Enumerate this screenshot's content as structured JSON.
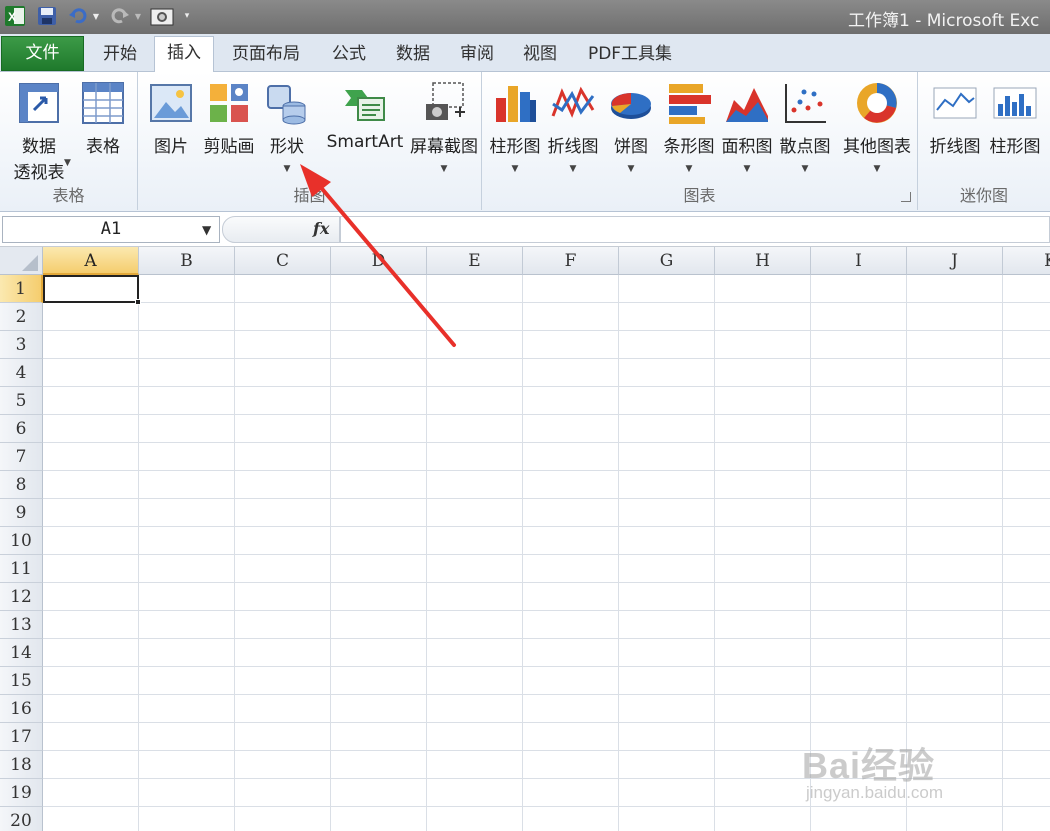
{
  "titlebar": {
    "app_title": "工作簿1 - Microsoft Exc"
  },
  "tabs": [
    {
      "label": "文件"
    },
    {
      "label": "开始"
    },
    {
      "label": "插入"
    },
    {
      "label": "页面布局"
    },
    {
      "label": "公式"
    },
    {
      "label": "数据"
    },
    {
      "label": "审阅"
    },
    {
      "label": "视图"
    },
    {
      "label": "PDF工具集"
    }
  ],
  "ribbon": {
    "groups": [
      {
        "label": "表格"
      },
      {
        "label": "插图"
      },
      {
        "label": "图表"
      },
      {
        "label": "迷你图"
      }
    ],
    "buttons": {
      "pivot_line1": "数据",
      "pivot_line2": "透视表",
      "table": "表格",
      "picture": "图片",
      "clipart": "剪贴画",
      "shapes": "形状",
      "smartart": "SmartArt",
      "screenshot": "屏幕截图",
      "column_chart": "柱形图",
      "line_chart": "折线图",
      "pie_chart": "饼图",
      "bar_chart": "条形图",
      "area_chart": "面积图",
      "scatter_chart": "散点图",
      "other_charts": "其他图表",
      "sparkline_line": "折线图",
      "sparkline_column": "柱形图"
    }
  },
  "formula_bar": {
    "name_box": "A1",
    "fx": "fx",
    "value": ""
  },
  "sheet": {
    "columns": [
      "A",
      "B",
      "C",
      "D",
      "E",
      "F",
      "G",
      "H",
      "I",
      "J",
      "K"
    ],
    "rows": [
      "1",
      "2",
      "3",
      "4",
      "5",
      "6",
      "7",
      "8",
      "9",
      "10",
      "11",
      "12",
      "13",
      "14",
      "15",
      "16",
      "17",
      "18",
      "19",
      "20"
    ],
    "selected_cell": "A1"
  },
  "watermark": {
    "main": "Bai经验",
    "sub": "jingyan.baidu.com"
  },
  "colors": {
    "file_tab": "#1f7a2c",
    "annotation_arrow": "#e8302a",
    "selected_header": "#f5cd6e"
  }
}
